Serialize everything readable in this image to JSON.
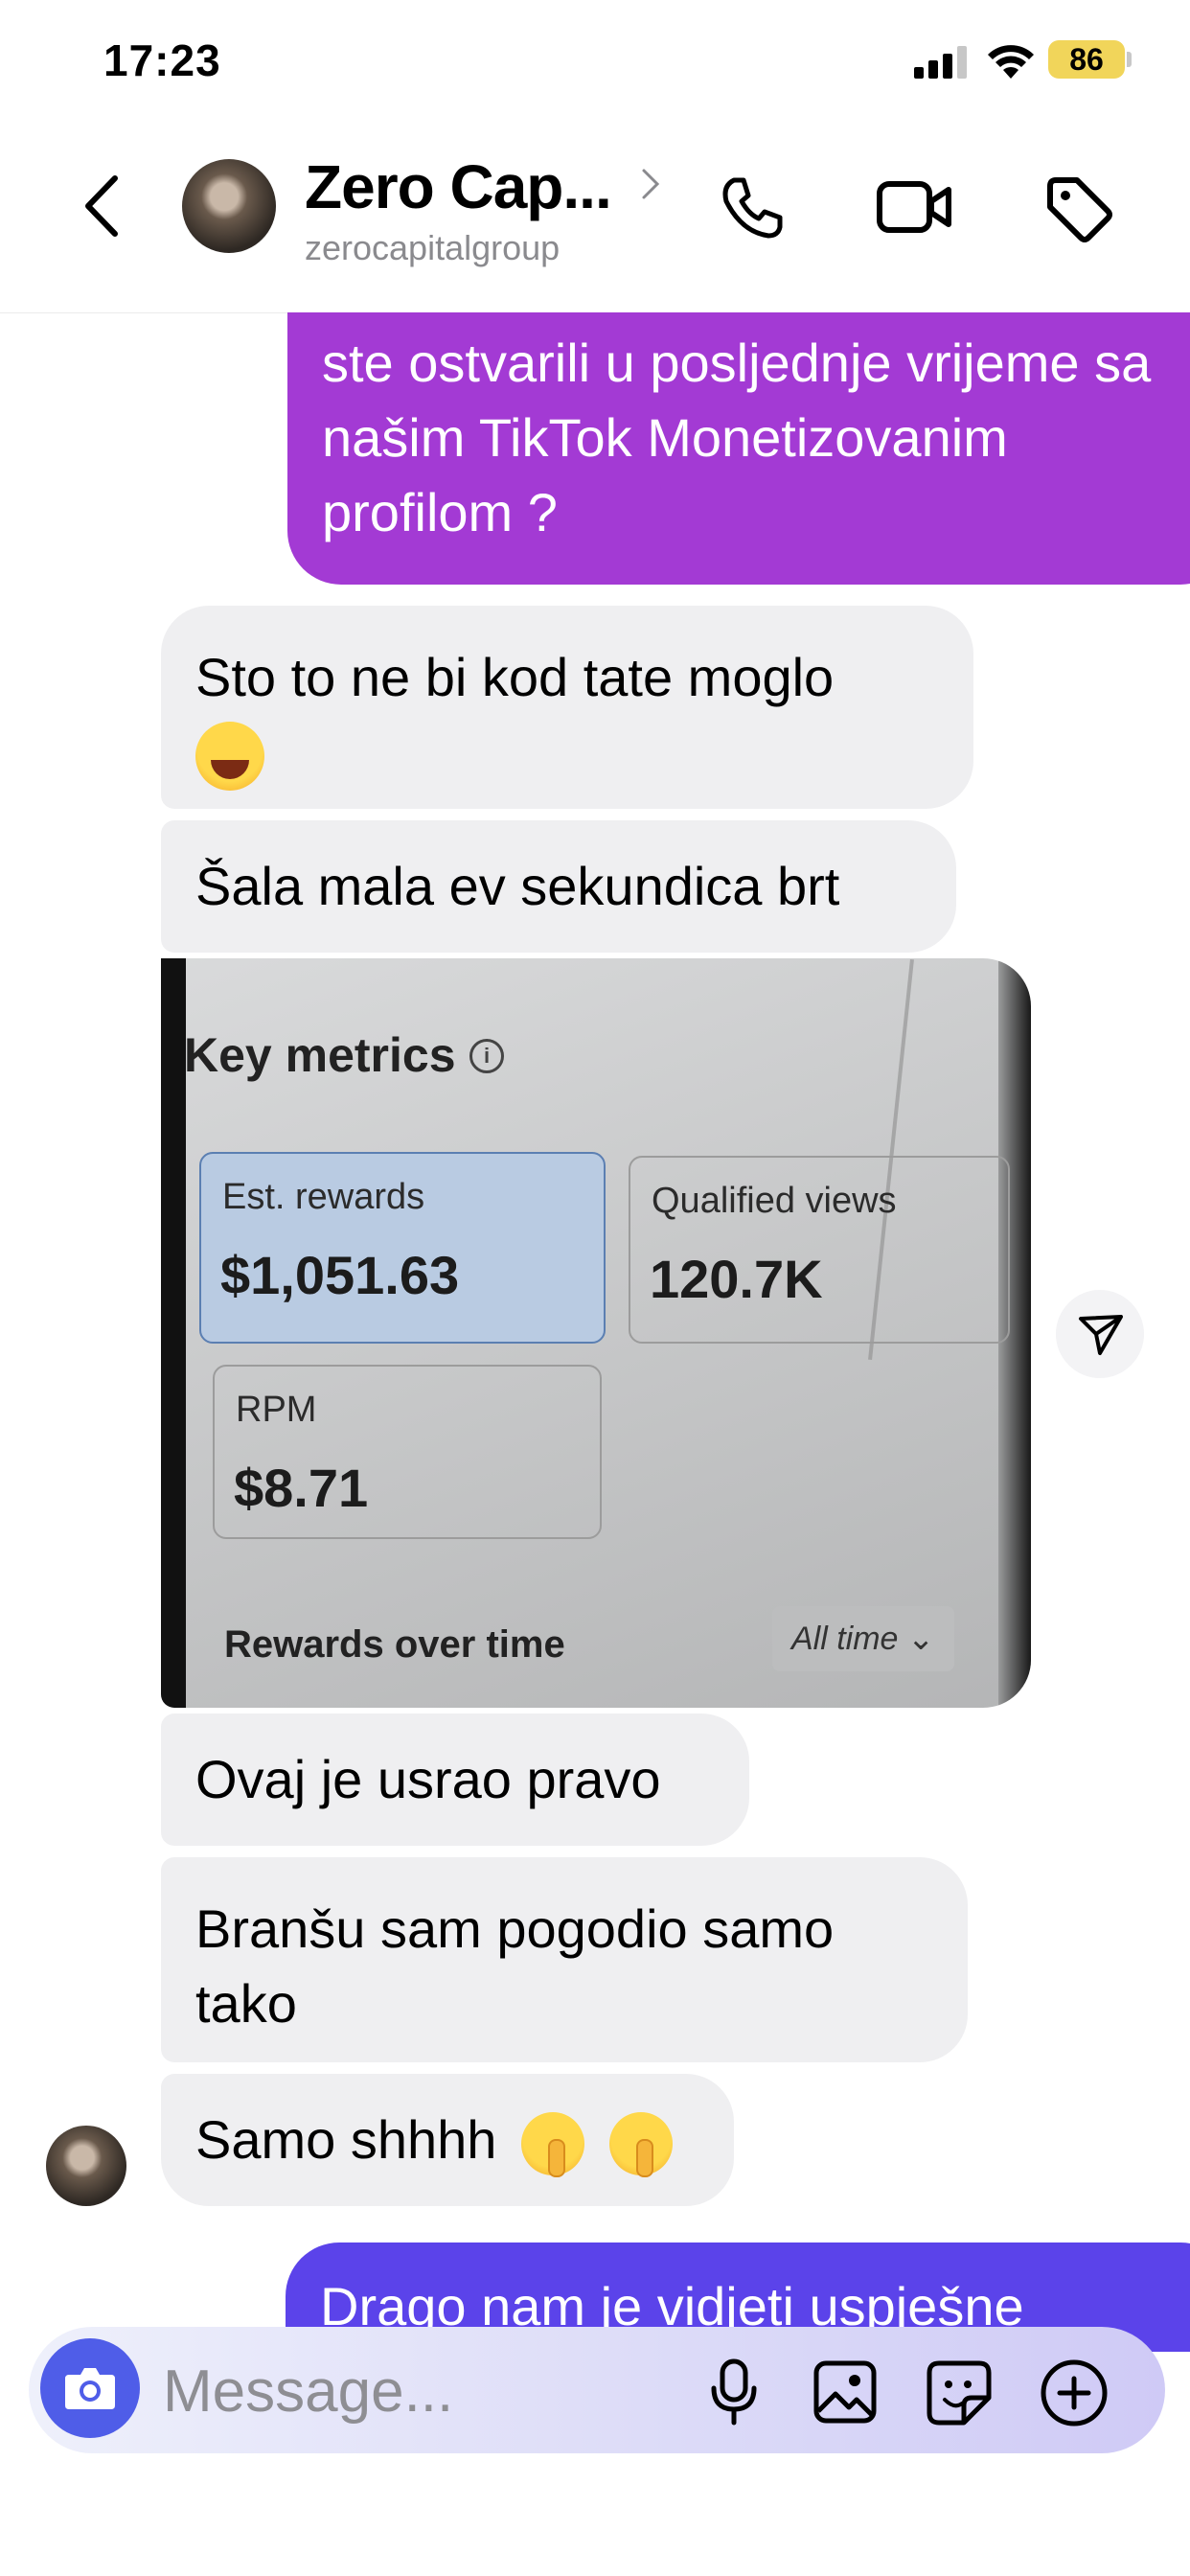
{
  "status_bar": {
    "time": "17:23",
    "battery": "86"
  },
  "header": {
    "name": "Zero Cap...",
    "handle": "zerocapitalgroup"
  },
  "messages": {
    "out_top": "ste ostvarili u posljednje vrijeme sa našim TikTok Monetizovanim profilom ?",
    "in_1": "Sto to ne bi kod tate moglo",
    "in_2": "Šala mala ev sekundica brt",
    "in_3": "Ovaj je usrao pravo",
    "in_4": "Branšu sam pogodio samo tako",
    "in_5": "Samo shhhh",
    "out_bottom": "Drago nam je vidjeti uspješne"
  },
  "screenshot": {
    "title": "Key metrics",
    "info": "i",
    "cards": [
      {
        "label": "Est. rewards",
        "value": "$1,051.63"
      },
      {
        "label": "Qualified views",
        "value": "120.7K"
      },
      {
        "label": "RPM",
        "value": "$8.71"
      }
    ],
    "rewards_over_time": "Rewards over time",
    "all_time": "All time"
  },
  "composer": {
    "placeholder": "Message..."
  },
  "colors": {
    "outgoing_purple": "#a33ad4",
    "outgoing_indigo": "#5b43ea",
    "incoming_gray": "#efeff1",
    "camera_blue": "#4f5de8"
  }
}
